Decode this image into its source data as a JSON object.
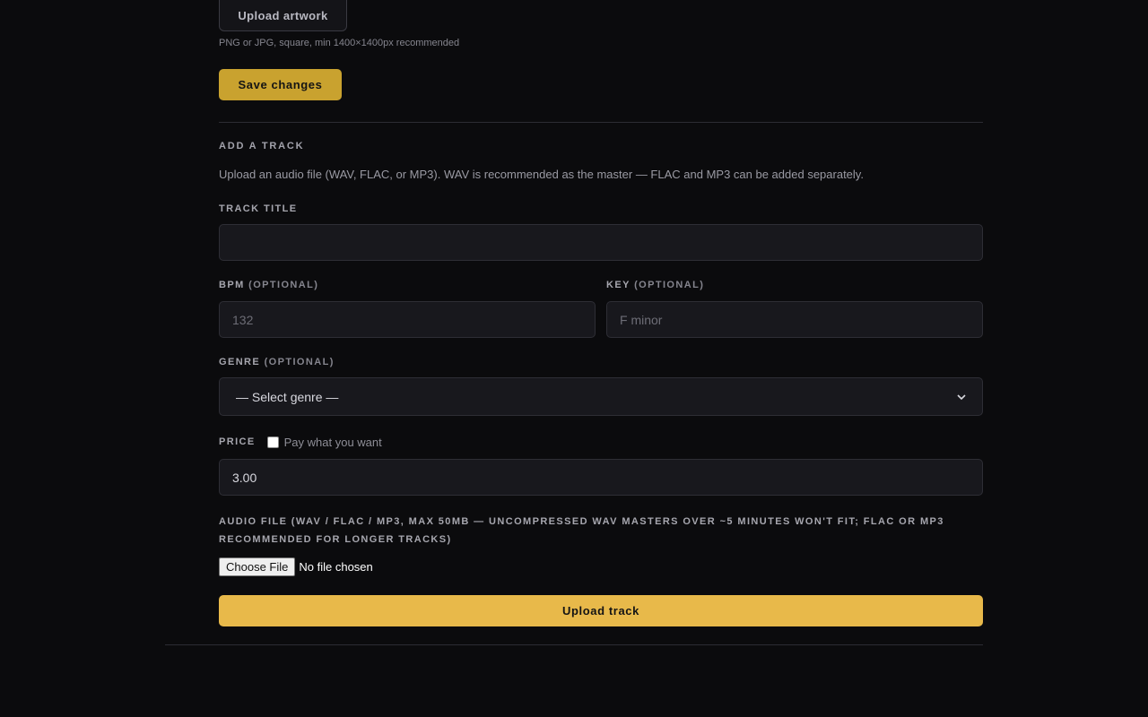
{
  "artwork": {
    "upload_label": "Upload artwork",
    "hint": "PNG or JPG, square, min 1400×1400px recommended",
    "save_label": "Save changes"
  },
  "add_track": {
    "heading": "ADD A TRACK",
    "description": "Upload an audio file (WAV, FLAC, or MP3). WAV is recommended as the master — FLAC and MP3 can be added separately.",
    "title_label": "TRACK TITLE",
    "title_value": "",
    "bpm_label": "BPM",
    "bpm_optional": "(OPTIONAL)",
    "bpm_placeholder": "132",
    "key_label": "KEY",
    "key_optional": "(OPTIONAL)",
    "key_placeholder": "F minor",
    "genre_label": "GENRE",
    "genre_optional": "(OPTIONAL)",
    "genre_selected": "— Select genre —",
    "price_label": "PRICE",
    "pwyw_label": "Pay what you want",
    "price_value": "3.00",
    "audio_label": "AUDIO FILE (WAV / FLAC / MP3, MAX 50MB — UNCOMPRESSED WAV MASTERS OVER ~5 MINUTES WON'T FIT; FLAC OR MP3 RECOMMENDED FOR LONGER TRACKS)",
    "choose_file_label": "Choose File",
    "file_status": "No file chosen",
    "upload_label": "Upload track"
  },
  "colors": {
    "accent": "#e8b94a",
    "accent_dark": "#c9a22f",
    "background": "#0b0b0d"
  }
}
